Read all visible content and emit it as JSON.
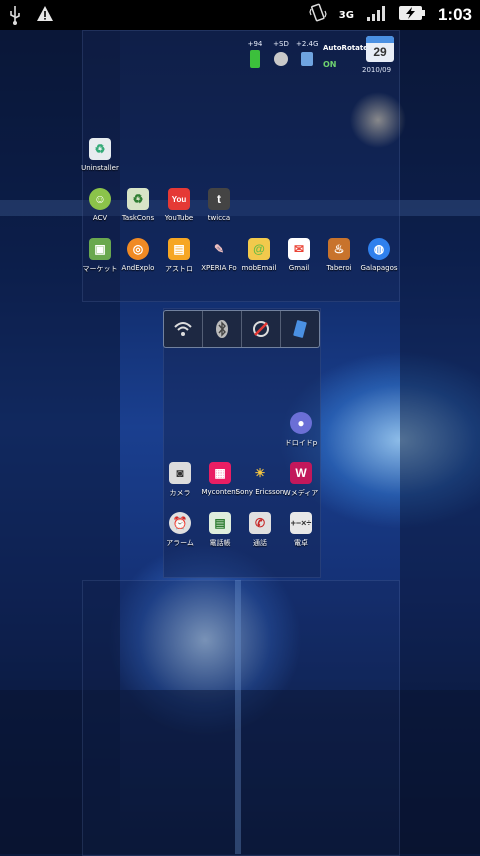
{
  "status_bar": {
    "network_type": "3G",
    "time": "1:03",
    "icons": [
      "usb-icon",
      "warning-icon",
      "vibrate-icon",
      "signal-icon",
      "battery-charging-icon"
    ]
  },
  "widgets": {
    "items": [
      {
        "label": "+94",
        "icon": "battery-icon",
        "color": "#3cbf3c"
      },
      {
        "label": "+SD",
        "icon": "sd-card-icon",
        "color": "#c9c9c9"
      },
      {
        "label": "+2.4G",
        "icon": "memory-icon",
        "color": "#6fa4e0"
      }
    ],
    "autorotate": {
      "title": "AutoRotate",
      "state": "ON"
    },
    "calendar": {
      "day": "29",
      "date": "2010/09"
    }
  },
  "home": {
    "row1": [
      {
        "label": "Uninstaller",
        "icon": "uninstaller-icon",
        "color": "#e7ecef"
      }
    ],
    "row2": [
      {
        "label": "ACV",
        "icon": "android-icon",
        "color": "#8bc34a"
      },
      {
        "label": "TaskCons",
        "icon": "recycle-icon",
        "color": "#d7e4c7"
      },
      {
        "label": "YouTube",
        "icon": "youtube-icon",
        "color": "#e53935"
      },
      {
        "label": "twicca",
        "icon": "twicca-icon",
        "color": "#444444"
      }
    ],
    "row3": [
      {
        "label": "マーケット",
        "icon": "market-icon",
        "color": "#6aa84f"
      },
      {
        "label": "AndExplo",
        "icon": "file-explorer-icon",
        "color": "#f08a24"
      },
      {
        "label": "アストロ",
        "icon": "astro-icon",
        "color": "#f6a623"
      },
      {
        "label": "XPERIA Fo",
        "icon": "pen-icon",
        "color": "#e0e0e0"
      },
      {
        "label": "mobEmail",
        "icon": "email-icon",
        "color": "#f2c94c"
      },
      {
        "label": "Gmail",
        "icon": "gmail-icon",
        "color": "#ea4335"
      },
      {
        "label": "Taberoi",
        "icon": "taberoi-icon",
        "color": "#c8732c"
      },
      {
        "label": "Galapagos",
        "icon": "globe-icon",
        "color": "#2f80ed"
      }
    ]
  },
  "power_control": {
    "items": [
      "wifi-icon",
      "bluetooth-icon",
      "gps-icon",
      "sync-icon"
    ]
  },
  "dock": {
    "row1": [
      {
        "label": "ドロイドp",
        "icon": "sphere-icon",
        "color": "#6b6fd6"
      }
    ],
    "row2": [
      {
        "label": "カメラ",
        "icon": "camera-icon",
        "color": "#dcdcdc"
      },
      {
        "label": "Mycontent",
        "icon": "mycontent-icon",
        "color": "#e91e63"
      },
      {
        "label": "Sony Ericsson",
        "icon": "weather-icon",
        "color": "#f4c542"
      },
      {
        "label": "Wメディア",
        "icon": "media-icon",
        "color": "#c2185b"
      }
    ],
    "row3": [
      {
        "label": "アラーム",
        "icon": "alarm-icon",
        "color": "#e0e0e0"
      },
      {
        "label": "電話帳",
        "icon": "contacts-icon",
        "color": "#dfeedd"
      },
      {
        "label": "通話",
        "icon": "phone-icon",
        "color": "#e0e0e0"
      },
      {
        "label": "電卓",
        "icon": "calculator-icon",
        "color": "#e8e8e8"
      }
    ]
  }
}
